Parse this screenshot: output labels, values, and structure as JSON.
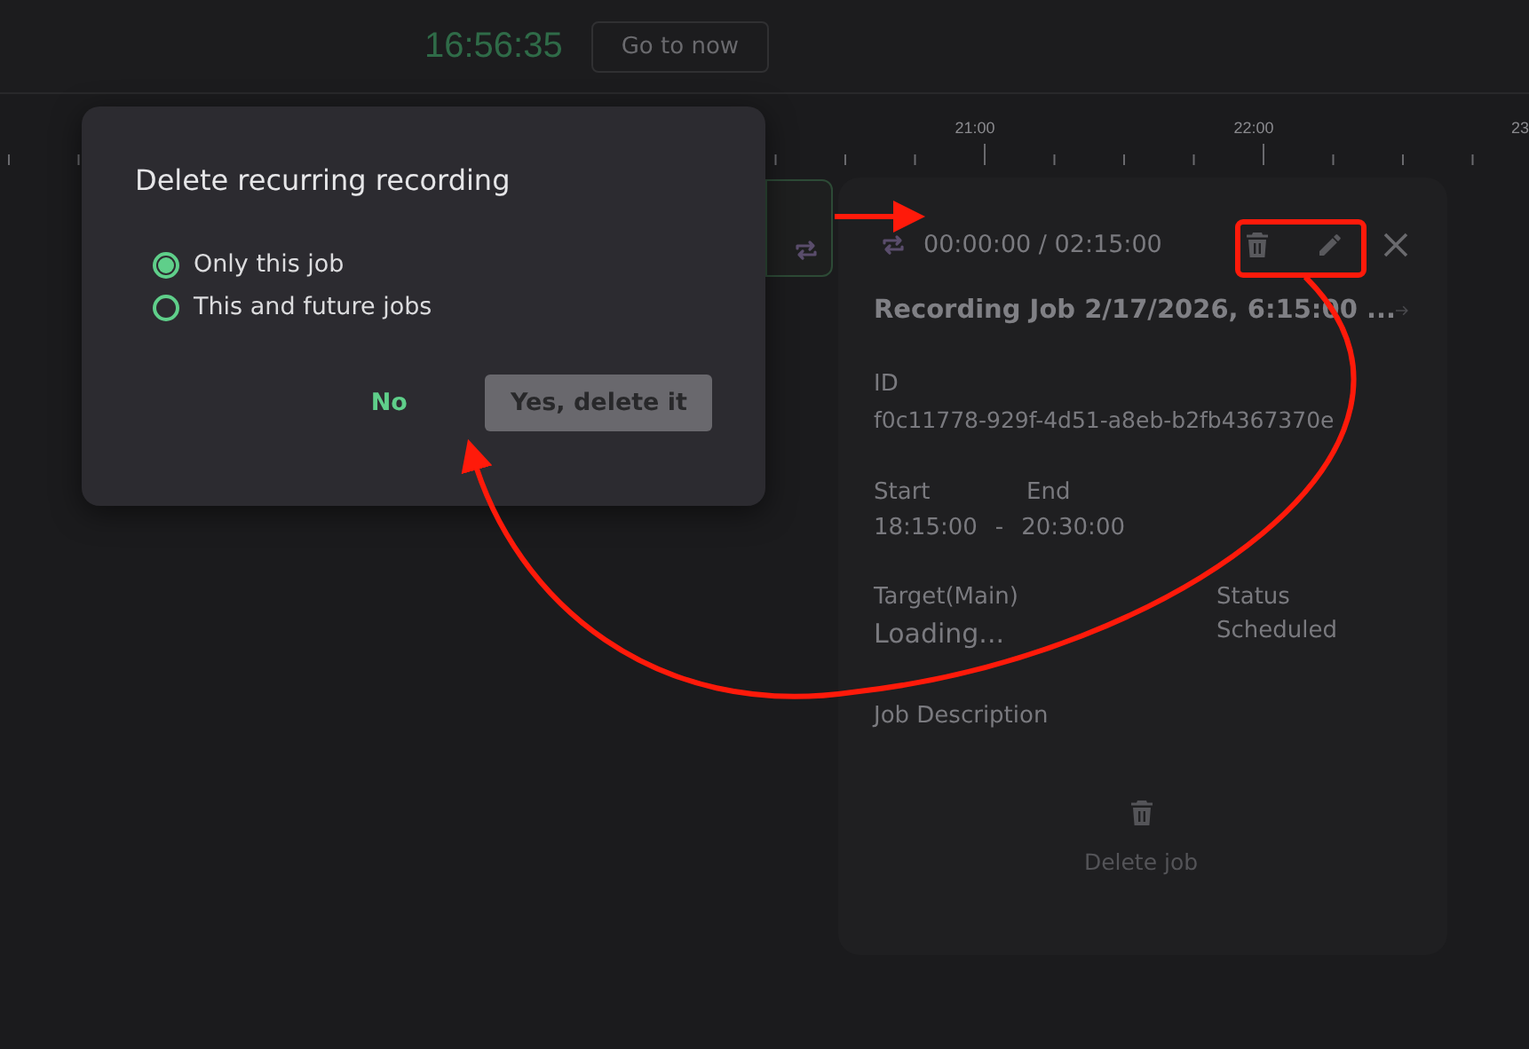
{
  "header": {
    "clock": "16:56:35",
    "go_button": "Go to now"
  },
  "timeline": {
    "labels": [
      "21:00",
      "22:00",
      "23"
    ]
  },
  "dialog": {
    "title": "Delete recurring recording",
    "options": [
      {
        "label": "Only this job",
        "selected": true
      },
      {
        "label": "This and future jobs",
        "selected": false
      }
    ],
    "buttons": [
      {
        "label": "No",
        "kind": "text"
      },
      {
        "label": "Yes, delete it",
        "kind": "filled"
      }
    ]
  },
  "details": {
    "time": "00:00:00 / 02:15:00",
    "title": "Recording Job 2/17/2026, 6:15:00 ...",
    "id_label": "ID",
    "id": "f0c11778-929f-4d51-a8eb-b2fb4367370e",
    "start_label": "Start",
    "end_label": "End",
    "start": "18:15:00",
    "separator": "-",
    "end": "20:30:00",
    "target_label": "Target(Main)",
    "target": "Loading...",
    "status_label": "Status",
    "status": "Scheduled",
    "description_label": "Job Description",
    "delete": "Delete job"
  }
}
